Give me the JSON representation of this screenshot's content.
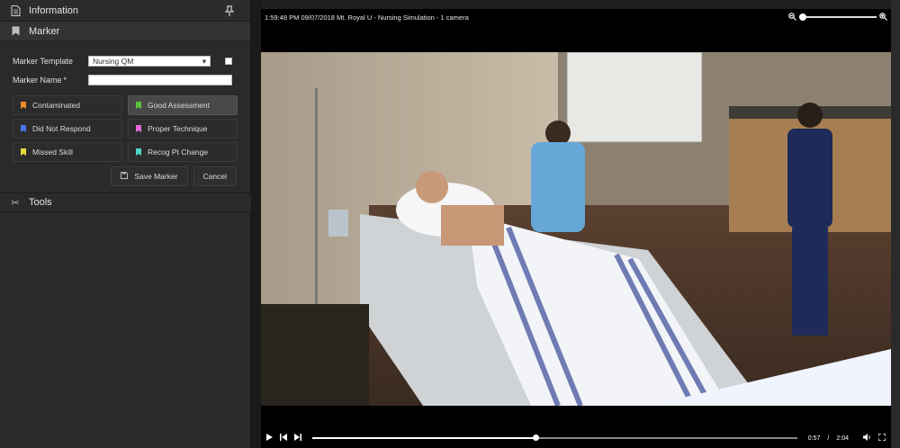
{
  "info_panel": {
    "title": "Information"
  },
  "marker_section": {
    "title": "Marker"
  },
  "form": {
    "template_label": "Marker Template",
    "template_value": "Nursing QM",
    "name_label": "Marker Name",
    "name_required": "*",
    "name_value": ""
  },
  "tags": [
    {
      "label": "Contaminated",
      "color": "#f08a2a",
      "active": false
    },
    {
      "label": "Good Assessment",
      "color": "#5cc23a",
      "active": true
    },
    {
      "label": "Did Not Respond",
      "color": "#4a74e8",
      "active": false
    },
    {
      "label": "Proper Technique",
      "color": "#e46ad8",
      "active": false
    },
    {
      "label": "Missed Skill",
      "color": "#e8d83a",
      "active": false
    },
    {
      "label": "Recog Pt Change",
      "color": "#4fd6c8",
      "active": false
    }
  ],
  "actions": {
    "save": "Save Marker",
    "cancel": "Cancel"
  },
  "tools_section": {
    "title": "Tools"
  },
  "video": {
    "title": "1:59:48 PM 09/07/2018 Mt. Royal U - Nursing Simulation - 1 camera",
    "current_time": "0:57",
    "separator": "/",
    "duration": "2:04",
    "progress": 0.46
  }
}
